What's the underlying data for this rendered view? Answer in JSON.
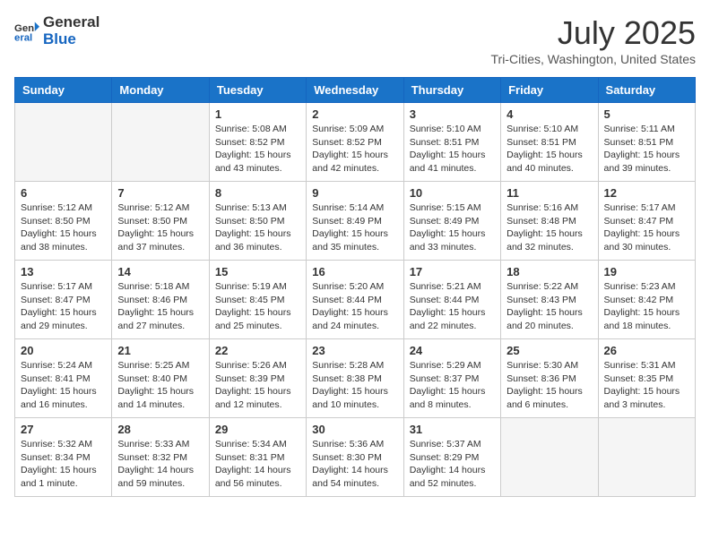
{
  "header": {
    "logo_line1": "General",
    "logo_line2": "Blue",
    "month": "July 2025",
    "location": "Tri-Cities, Washington, United States"
  },
  "days_of_week": [
    "Sunday",
    "Monday",
    "Tuesday",
    "Wednesday",
    "Thursday",
    "Friday",
    "Saturday"
  ],
  "weeks": [
    [
      {
        "day": "",
        "empty": true
      },
      {
        "day": "",
        "empty": true
      },
      {
        "day": "1",
        "sunrise": "Sunrise: 5:08 AM",
        "sunset": "Sunset: 8:52 PM",
        "daylight": "Daylight: 15 hours and 43 minutes."
      },
      {
        "day": "2",
        "sunrise": "Sunrise: 5:09 AM",
        "sunset": "Sunset: 8:52 PM",
        "daylight": "Daylight: 15 hours and 42 minutes."
      },
      {
        "day": "3",
        "sunrise": "Sunrise: 5:10 AM",
        "sunset": "Sunset: 8:51 PM",
        "daylight": "Daylight: 15 hours and 41 minutes."
      },
      {
        "day": "4",
        "sunrise": "Sunrise: 5:10 AM",
        "sunset": "Sunset: 8:51 PM",
        "daylight": "Daylight: 15 hours and 40 minutes."
      },
      {
        "day": "5",
        "sunrise": "Sunrise: 5:11 AM",
        "sunset": "Sunset: 8:51 PM",
        "daylight": "Daylight: 15 hours and 39 minutes."
      }
    ],
    [
      {
        "day": "6",
        "sunrise": "Sunrise: 5:12 AM",
        "sunset": "Sunset: 8:50 PM",
        "daylight": "Daylight: 15 hours and 38 minutes."
      },
      {
        "day": "7",
        "sunrise": "Sunrise: 5:12 AM",
        "sunset": "Sunset: 8:50 PM",
        "daylight": "Daylight: 15 hours and 37 minutes."
      },
      {
        "day": "8",
        "sunrise": "Sunrise: 5:13 AM",
        "sunset": "Sunset: 8:50 PM",
        "daylight": "Daylight: 15 hours and 36 minutes."
      },
      {
        "day": "9",
        "sunrise": "Sunrise: 5:14 AM",
        "sunset": "Sunset: 8:49 PM",
        "daylight": "Daylight: 15 hours and 35 minutes."
      },
      {
        "day": "10",
        "sunrise": "Sunrise: 5:15 AM",
        "sunset": "Sunset: 8:49 PM",
        "daylight": "Daylight: 15 hours and 33 minutes."
      },
      {
        "day": "11",
        "sunrise": "Sunrise: 5:16 AM",
        "sunset": "Sunset: 8:48 PM",
        "daylight": "Daylight: 15 hours and 32 minutes."
      },
      {
        "day": "12",
        "sunrise": "Sunrise: 5:17 AM",
        "sunset": "Sunset: 8:47 PM",
        "daylight": "Daylight: 15 hours and 30 minutes."
      }
    ],
    [
      {
        "day": "13",
        "sunrise": "Sunrise: 5:17 AM",
        "sunset": "Sunset: 8:47 PM",
        "daylight": "Daylight: 15 hours and 29 minutes."
      },
      {
        "day": "14",
        "sunrise": "Sunrise: 5:18 AM",
        "sunset": "Sunset: 8:46 PM",
        "daylight": "Daylight: 15 hours and 27 minutes."
      },
      {
        "day": "15",
        "sunrise": "Sunrise: 5:19 AM",
        "sunset": "Sunset: 8:45 PM",
        "daylight": "Daylight: 15 hours and 25 minutes."
      },
      {
        "day": "16",
        "sunrise": "Sunrise: 5:20 AM",
        "sunset": "Sunset: 8:44 PM",
        "daylight": "Daylight: 15 hours and 24 minutes."
      },
      {
        "day": "17",
        "sunrise": "Sunrise: 5:21 AM",
        "sunset": "Sunset: 8:44 PM",
        "daylight": "Daylight: 15 hours and 22 minutes."
      },
      {
        "day": "18",
        "sunrise": "Sunrise: 5:22 AM",
        "sunset": "Sunset: 8:43 PM",
        "daylight": "Daylight: 15 hours and 20 minutes."
      },
      {
        "day": "19",
        "sunrise": "Sunrise: 5:23 AM",
        "sunset": "Sunset: 8:42 PM",
        "daylight": "Daylight: 15 hours and 18 minutes."
      }
    ],
    [
      {
        "day": "20",
        "sunrise": "Sunrise: 5:24 AM",
        "sunset": "Sunset: 8:41 PM",
        "daylight": "Daylight: 15 hours and 16 minutes."
      },
      {
        "day": "21",
        "sunrise": "Sunrise: 5:25 AM",
        "sunset": "Sunset: 8:40 PM",
        "daylight": "Daylight: 15 hours and 14 minutes."
      },
      {
        "day": "22",
        "sunrise": "Sunrise: 5:26 AM",
        "sunset": "Sunset: 8:39 PM",
        "daylight": "Daylight: 15 hours and 12 minutes."
      },
      {
        "day": "23",
        "sunrise": "Sunrise: 5:28 AM",
        "sunset": "Sunset: 8:38 PM",
        "daylight": "Daylight: 15 hours and 10 minutes."
      },
      {
        "day": "24",
        "sunrise": "Sunrise: 5:29 AM",
        "sunset": "Sunset: 8:37 PM",
        "daylight": "Daylight: 15 hours and 8 minutes."
      },
      {
        "day": "25",
        "sunrise": "Sunrise: 5:30 AM",
        "sunset": "Sunset: 8:36 PM",
        "daylight": "Daylight: 15 hours and 6 minutes."
      },
      {
        "day": "26",
        "sunrise": "Sunrise: 5:31 AM",
        "sunset": "Sunset: 8:35 PM",
        "daylight": "Daylight: 15 hours and 3 minutes."
      }
    ],
    [
      {
        "day": "27",
        "sunrise": "Sunrise: 5:32 AM",
        "sunset": "Sunset: 8:34 PM",
        "daylight": "Daylight: 15 hours and 1 minute."
      },
      {
        "day": "28",
        "sunrise": "Sunrise: 5:33 AM",
        "sunset": "Sunset: 8:32 PM",
        "daylight": "Daylight: 14 hours and 59 minutes."
      },
      {
        "day": "29",
        "sunrise": "Sunrise: 5:34 AM",
        "sunset": "Sunset: 8:31 PM",
        "daylight": "Daylight: 14 hours and 56 minutes."
      },
      {
        "day": "30",
        "sunrise": "Sunrise: 5:36 AM",
        "sunset": "Sunset: 8:30 PM",
        "daylight": "Daylight: 14 hours and 54 minutes."
      },
      {
        "day": "31",
        "sunrise": "Sunrise: 5:37 AM",
        "sunset": "Sunset: 8:29 PM",
        "daylight": "Daylight: 14 hours and 52 minutes."
      },
      {
        "day": "",
        "empty": true
      },
      {
        "day": "",
        "empty": true
      }
    ]
  ]
}
